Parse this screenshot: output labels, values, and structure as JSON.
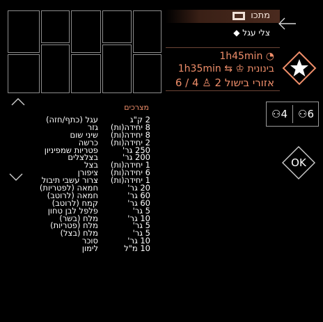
{
  "header": {
    "title": "מתכו",
    "dish": "צלי עגל ◆"
  },
  "info": {
    "time_total": "◔ 1h45min",
    "time_cook": "⇆ 1h35min",
    "difficulty": "בינונית",
    "zones": "אזורי בישול 2",
    "people_ratio": "4 / 6"
  },
  "servings": {
    "left": "4",
    "right": "6"
  },
  "buttons": {
    "ok": "OK"
  },
  "ingredients_title": "מצרכים",
  "ingredients": [
    {
      "name": "עגל (כתף/חזה)",
      "qty": "2 ק\"ג"
    },
    {
      "name": "גזר",
      "qty": "8 יחידה(ות)"
    },
    {
      "name": "שיני שום",
      "qty": "8 יחידה(ות)"
    },
    {
      "name": "כרשה",
      "qty": "2 יחידה(ות)"
    },
    {
      "name": "פטריות שמפיניון",
      "qty": "250 גר'"
    },
    {
      "name": "בצלצלים",
      "qty": "200 גר'"
    },
    {
      "name": "בצל",
      "qty": "1 יחידה(ות)"
    },
    {
      "name": "ציפורן",
      "qty": "6 יחידה(ות)"
    },
    {
      "name": "צרור עשבי תיבול",
      "qty": "1 יחידה(ות)"
    },
    {
      "name": "חמאה (לפטריות)",
      "qty": "20 גר'"
    },
    {
      "name": "חמאה (לרוטב)",
      "qty": "60 גר'"
    },
    {
      "name": "קמח (לרוטב)",
      "qty": "60 גר'"
    },
    {
      "name": "פלפל לבן טחון",
      "qty": "5 גר'"
    },
    {
      "name": "מלח (בשר)",
      "qty": "10 גר'"
    },
    {
      "name": "מלח (פטריות)",
      "qty": "5 גר'"
    },
    {
      "name": "מלח (בצל)",
      "qty": "5 גר'"
    },
    {
      "name": "סוכר",
      "qty": "10 גר'"
    },
    {
      "name": "לימון",
      "qty": "10 מ\"ל"
    }
  ],
  "colors": {
    "accent": "#ef8e6a",
    "border": "#8d8d8d",
    "bar": "#4a2a1e"
  },
  "icons": [
    "back-arrow-icon",
    "book-icon",
    "star-icon",
    "person-icon",
    "chevron-up-icon",
    "chevron-down-icon"
  ]
}
